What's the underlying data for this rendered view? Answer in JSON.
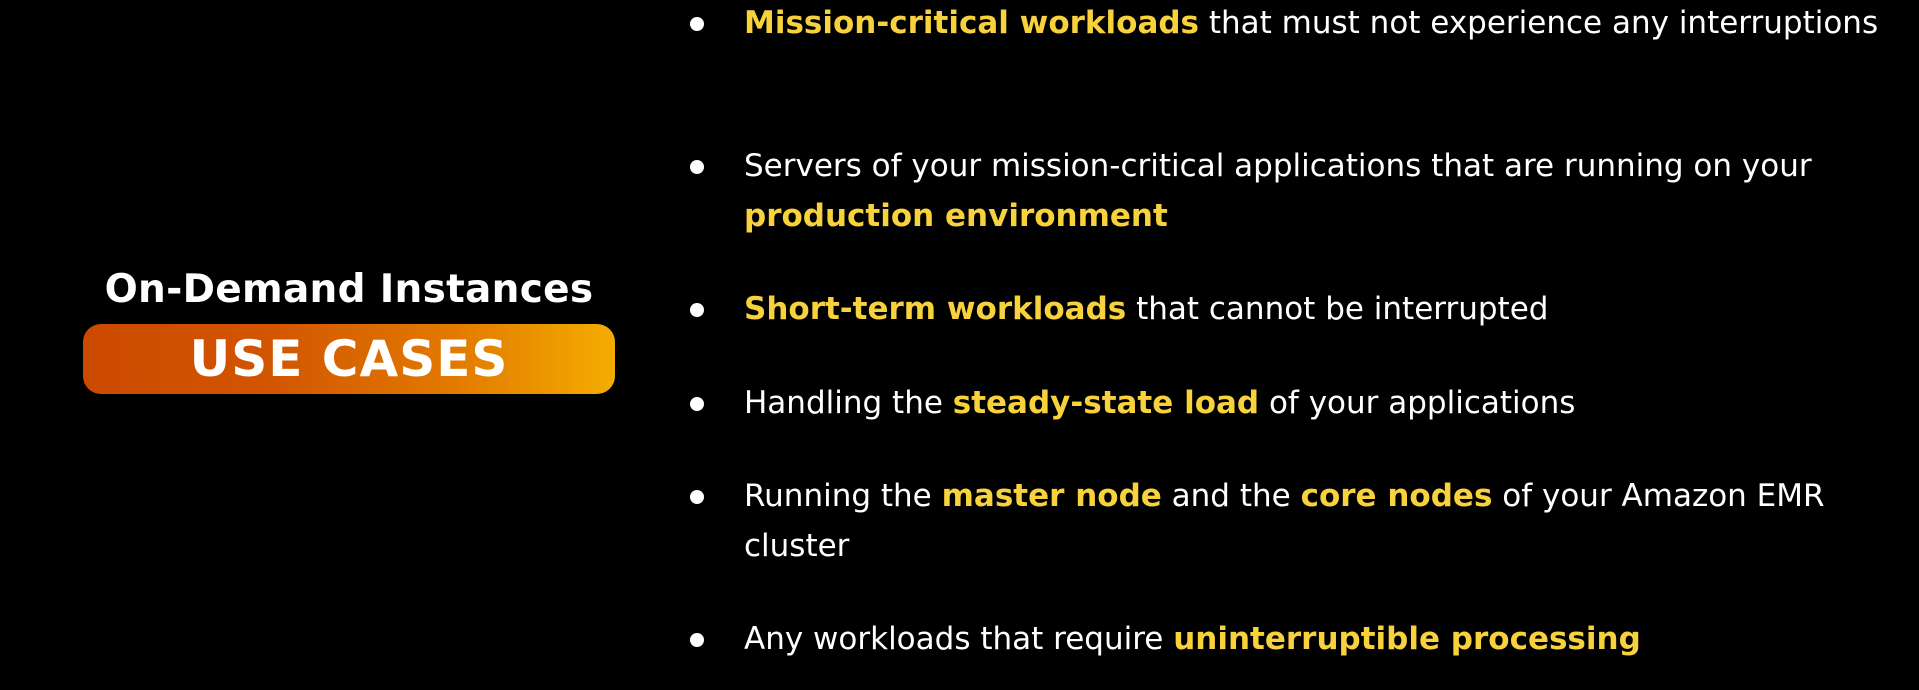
{
  "left": {
    "title": "On-Demand Instances",
    "badge": "USE CASES"
  },
  "colors": {
    "background": "#000000",
    "text": "#ffffff",
    "highlight": "#f7d23c",
    "badge_gradient_start": "#cc4a00",
    "badge_gradient_end": "#f4ac00"
  },
  "use_cases": [
    {
      "segments": [
        {
          "text": "Mission-critical workloads",
          "highlight": true
        },
        {
          "text": " that must not experience any interruptions",
          "highlight": false
        }
      ]
    },
    {
      "segments": [
        {
          "text": "Servers of your mission-critical applications that are running on your ",
          "highlight": false
        },
        {
          "text": "production environment",
          "highlight": true
        }
      ]
    },
    {
      "segments": [
        {
          "text": "Short-term workloads",
          "highlight": true
        },
        {
          "text": " that cannot be interrupted",
          "highlight": false
        }
      ]
    },
    {
      "segments": [
        {
          "text": "Handling the ",
          "highlight": false
        },
        {
          "text": "steady-state load",
          "highlight": true
        },
        {
          "text": " of your applications",
          "highlight": false
        }
      ]
    },
    {
      "segments": [
        {
          "text": "Running the ",
          "highlight": false
        },
        {
          "text": "master node",
          "highlight": true
        },
        {
          "text": " and the ",
          "highlight": false
        },
        {
          "text": "core nodes",
          "highlight": true
        },
        {
          "text": " of your Amazon EMR cluster",
          "highlight": false
        }
      ]
    },
    {
      "segments": [
        {
          "text": "Any workloads that require ",
          "highlight": false
        },
        {
          "text": "uninterruptible processing",
          "highlight": true
        }
      ]
    }
  ]
}
